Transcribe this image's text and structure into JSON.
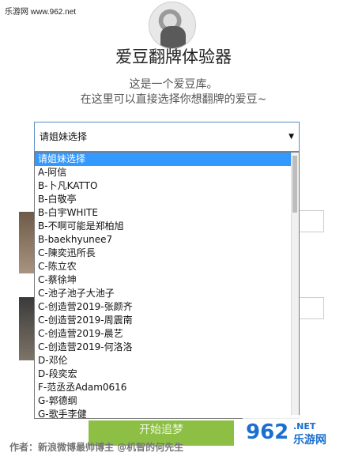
{
  "site_watermark": "乐游网 www.962.net",
  "page": {
    "title": "爱豆翻牌体验器",
    "intro_line1": "这是一个爱豆库。",
    "intro_line2": "在这里可以直接选择你想翻牌的爱豆~"
  },
  "select": {
    "current": "请姐妹选择",
    "options": [
      "请姐妹选择",
      "A-阿信",
      "B-卜凡KATTO",
      "B-白敬亭",
      "B-白宇WHITE",
      "B-不啊可能是郑柏旭",
      "B-baekhyunee7",
      "C-陳奕迅所長",
      "C-陈立农",
      "C-蔡徐坤",
      "C-池子池子大池子",
      "C-创造营2019-张颜齐",
      "C-创造营2019-周震南",
      "C-创造营2019-晨艺",
      "C-创造营2019-何洛洛",
      "D-邓伦",
      "D-段奕宏",
      "F-范丞丞Adam0616",
      "G-郭德纲",
      "G-歌手李健"
    ]
  },
  "start_button": "开始追梦",
  "footer": "作者：新浪微博最帅博主 @机智的何先生",
  "corner_logo": {
    "number": "962",
    ".net": ".NET",
    "name": "乐游网"
  },
  "colors": {
    "button": "#8dbf45",
    "selected_option": "#3399ff",
    "logo_blue": "#1a6fd1"
  }
}
